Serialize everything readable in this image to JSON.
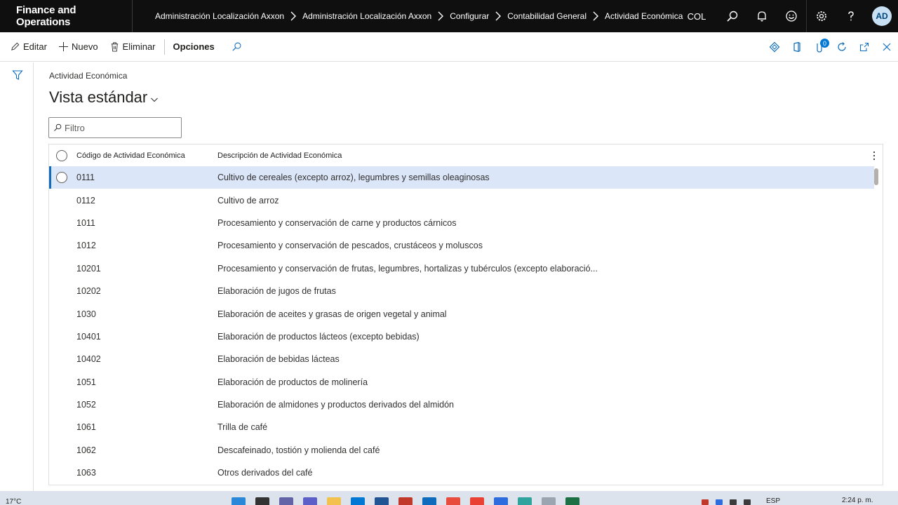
{
  "topbar": {
    "brand": "Finance and Operations",
    "breadcrumbs": [
      "Administración Localización Axxon",
      "Administración Localización Axxon",
      "Configurar",
      "Contabilidad General",
      "Actividad Económica"
    ],
    "company": "COL",
    "avatar_initials": "AD"
  },
  "actions": {
    "edit": "Editar",
    "new": "Nuevo",
    "delete": "Eliminar",
    "options": "Opciones",
    "notification_count": "0"
  },
  "page": {
    "caption": "Actividad Económica",
    "view_name": "Vista estándar",
    "filter_placeholder": "Filtro"
  },
  "grid": {
    "columns": [
      "Código de Actividad Económica",
      "Descripción de Actividad Económica"
    ],
    "rows": [
      {
        "code": "0111",
        "desc": "Cultivo de cereales (excepto arroz), legumbres y semillas oleaginosas"
      },
      {
        "code": "0112",
        "desc": "Cultivo de arroz"
      },
      {
        "code": "1011",
        "desc": "Procesamiento y conservación de carne y productos cárnicos"
      },
      {
        "code": "1012",
        "desc": "Procesamiento y conservación de pescados, crustáceos y moluscos"
      },
      {
        "code": "10201",
        "desc": "Procesamiento y conservación de frutas, legumbres, hortalizas y tubérculos (excepto elaboració..."
      },
      {
        "code": "10202",
        "desc": "Elaboración de jugos de frutas"
      },
      {
        "code": "1030",
        "desc": "Elaboración de aceites y grasas de origen vegetal y animal"
      },
      {
        "code": "10401",
        "desc": "Elaboración de productos lácteos (excepto bebidas)"
      },
      {
        "code": "10402",
        "desc": "Elaboración de bebidas lácteas"
      },
      {
        "code": "1051",
        "desc": "Elaboración de productos de molinería"
      },
      {
        "code": "1052",
        "desc": "Elaboración de almidones y productos derivados del almidón"
      },
      {
        "code": "1061",
        "desc": "Trilla de café"
      },
      {
        "code": "1062",
        "desc": "Descafeinado, tostión y molienda del café"
      },
      {
        "code": "1063",
        "desc": "Otros derivados del café"
      }
    ],
    "selected_index": 0
  },
  "taskbar": {
    "temperature": "17°C",
    "language": "ESP",
    "time": "2:24 p. m."
  },
  "colors": {
    "topbar_bg": "#0f0f0f",
    "selected_row_bg": "#dbe6f8",
    "accent": "#0f6cbd"
  },
  "icons": {
    "topbar": [
      "search-icon",
      "bell-icon",
      "smiley-icon",
      "gear-icon",
      "help-icon"
    ],
    "action_right": [
      "diamond-icon",
      "office-icon",
      "attachment-icon",
      "refresh-icon",
      "popout-icon",
      "close-icon"
    ]
  }
}
